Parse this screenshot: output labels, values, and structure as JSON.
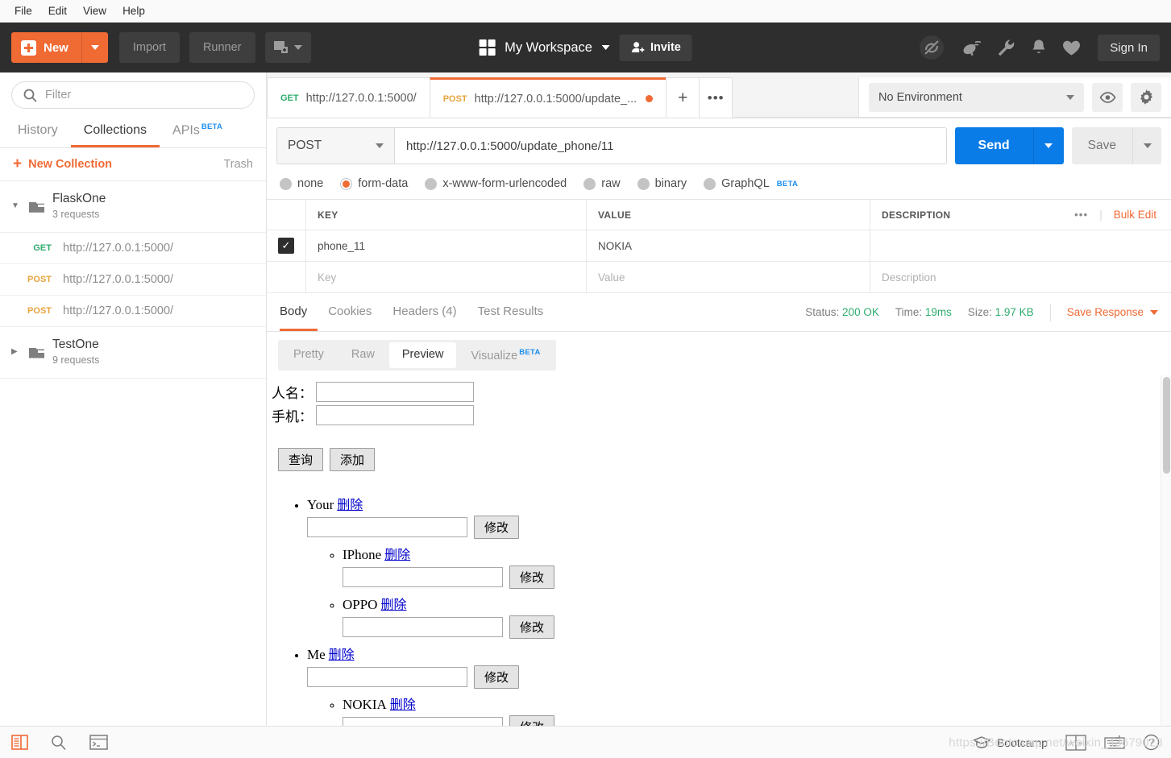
{
  "menubar": {
    "items": [
      "File",
      "Edit",
      "View",
      "Help"
    ]
  },
  "header": {
    "new_label": "New",
    "import_label": "Import",
    "runner_label": "Runner",
    "new_tab_icon": "new-window-icon",
    "workspace_name": "My Workspace",
    "invite_label": "Invite",
    "sign_in_label": "Sign In",
    "icons": [
      "sync-off-icon",
      "satellite-icon",
      "wrench-icon",
      "bell-icon",
      "heart-icon"
    ],
    "accent_color": "#f06a34",
    "background_color": "#2e2e2e"
  },
  "sidebar": {
    "filter_placeholder": "Filter",
    "tabs": [
      {
        "label": "History",
        "active": false,
        "beta": ""
      },
      {
        "label": "Collections",
        "active": true,
        "beta": ""
      },
      {
        "label": "APIs",
        "active": false,
        "beta": "BETA"
      }
    ],
    "new_collection_label": "New Collection",
    "trash_label": "Trash",
    "collections": [
      {
        "name": "FlaskOne",
        "count_label": "3 requests",
        "expanded": true,
        "requests": [
          {
            "method": "GET",
            "url": "http://127.0.0.1:5000/"
          },
          {
            "method": "POST",
            "url": "http://127.0.0.1:5000/"
          },
          {
            "method": "POST",
            "url": "http://127.0.0.1:5000/"
          }
        ]
      },
      {
        "name": "TestOne",
        "count_label": "9 requests",
        "expanded": false,
        "requests": []
      }
    ]
  },
  "tabstrip": {
    "tabs": [
      {
        "method": "GET",
        "url": "http://127.0.0.1:5000/",
        "active": false,
        "unsaved": false
      },
      {
        "method": "POST",
        "url": "http://127.0.0.1:5000/update_...",
        "active": true,
        "unsaved": true
      }
    ],
    "add_tab_label": "+",
    "more_label": "•••"
  },
  "environment": {
    "selected": "No Environment",
    "eye_icon": "eye-icon",
    "gear_icon": "gear-icon"
  },
  "request": {
    "method": "POST",
    "url": "http://127.0.0.1:5000/update_phone/11",
    "send_label": "Send",
    "save_label": "Save",
    "body_types": [
      {
        "label": "none",
        "selected": false,
        "beta": ""
      },
      {
        "label": "form-data",
        "selected": true,
        "beta": ""
      },
      {
        "label": "x-www-form-urlencoded",
        "selected": false,
        "beta": ""
      },
      {
        "label": "raw",
        "selected": false,
        "beta": ""
      },
      {
        "label": "binary",
        "selected": false,
        "beta": ""
      },
      {
        "label": "GraphQL",
        "selected": false,
        "beta": "BETA"
      }
    ],
    "table": {
      "columns": [
        "KEY",
        "VALUE",
        "DESCRIPTION"
      ],
      "dots_label": "•••",
      "bulk_edit_label": "Bulk Edit",
      "rows": [
        {
          "checked": true,
          "key": "phone_11",
          "value": "NOKIA",
          "description": ""
        }
      ],
      "placeholder_row": {
        "key": "Key",
        "value": "Value",
        "description": "Description"
      }
    }
  },
  "response": {
    "tabs": [
      {
        "label": "Body",
        "active": true
      },
      {
        "label": "Cookies",
        "active": false
      },
      {
        "label": "Headers (4)",
        "active": false
      },
      {
        "label": "Test Results",
        "active": false
      }
    ],
    "status_label": "Status:",
    "status_value": "200 OK",
    "time_label": "Time:",
    "time_value": "19ms",
    "size_label": "Size:",
    "size_value": "1.97 KB",
    "save_response_label": "Save Response",
    "view_modes": [
      {
        "label": "Pretty",
        "active": false,
        "beta": ""
      },
      {
        "label": "Raw",
        "active": false,
        "beta": ""
      },
      {
        "label": "Preview",
        "active": true,
        "beta": ""
      },
      {
        "label": "Visualize",
        "active": false,
        "beta": "BETA"
      }
    ]
  },
  "preview": {
    "form": {
      "name_label": "人名：",
      "phone_label": "手机：",
      "name_value": "",
      "phone_value": "",
      "query_button": "查询",
      "add_button": "添加"
    },
    "delete_link": "删除",
    "edit_button": "修改",
    "people": [
      {
        "name": "Your",
        "edit_value": "",
        "phones": [
          {
            "name": "IPhone",
            "edit_value": ""
          },
          {
            "name": "OPPO",
            "edit_value": ""
          }
        ]
      },
      {
        "name": "Me",
        "edit_value": "",
        "phones": [
          {
            "name": "NOKIA",
            "edit_value": ""
          }
        ]
      }
    ]
  },
  "footer": {
    "left_icons": [
      "sidebar-toggle-icon",
      "search-icon",
      "console-icon"
    ],
    "bootcamp_label": "Bootcamp",
    "right_icons": [
      "two-pane-icon",
      "keyboard-icon",
      "help-icon"
    ],
    "watermark": "https://Bootcamp.net/weixin_43679023"
  }
}
